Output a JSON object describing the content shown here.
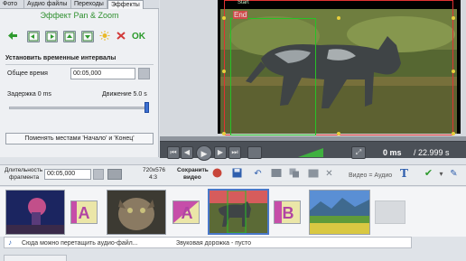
{
  "tabs": [
    {
      "label": "Фото"
    },
    {
      "label": "Аудио файлы"
    },
    {
      "label": "Переходы"
    },
    {
      "label": "Эффекты"
    }
  ],
  "effect_title": "Эффект Pan & Zoom",
  "toolbar": {
    "ok_label": "OK",
    "buttons": [
      "arrow-left-icon",
      "frame-arrow-icon",
      "frame-up-icon",
      "frame-left-icon",
      "frame-down-icon",
      "sun-icon",
      "delete-icon"
    ]
  },
  "time_section": {
    "header": "Установить временные интервалы",
    "total_label": "Общее время",
    "total_value": "00:05,000",
    "delay_label": "Задержка 0 ms",
    "motion_label": "Движение 5.0 s",
    "slider_value": 1.0
  },
  "swap_button": "Поменять местами 'Начало' и 'Конец'",
  "preview": {
    "end_label": "End",
    "start_label": "Start"
  },
  "player": {
    "current_time": "0 ms",
    "total_time": "/ 22.999 s"
  },
  "timeline": {
    "duration_label_1": "Длительность",
    "duration_label_2": "фрагмента",
    "duration_value": "00:05,000",
    "resolution_1": "720x576",
    "resolution_2": "4:3",
    "save_label_1": "Сохранить",
    "save_label_2": "видео",
    "audio_mode": "Видео = Аудио"
  },
  "storyboard": {
    "transition_letters": [
      "A",
      "A",
      "B"
    ]
  },
  "audio_strip": {
    "hint": "Сюда можно перетащить аудио-файл...",
    "track": "Звуковая дорожка - пусто"
  },
  "colors": {
    "accent_green": "#2e8f2e",
    "selection_blue": "#4a78c8",
    "frame_red": "#e03232",
    "frame_green": "#27c227"
  }
}
